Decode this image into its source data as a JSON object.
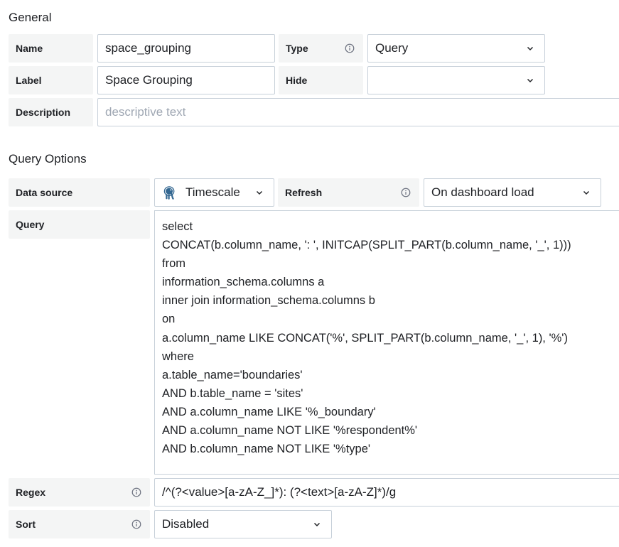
{
  "general": {
    "title": "General",
    "name_label": "Name",
    "name_value": "space_grouping",
    "type_label": "Type",
    "type_value": "Query",
    "label_label": "Label",
    "label_value": "Space Grouping",
    "hide_label": "Hide",
    "hide_value": "",
    "description_label": "Description",
    "description_placeholder": "descriptive text"
  },
  "query_options": {
    "title": "Query Options",
    "datasource_label": "Data source",
    "datasource_value": "Timescale",
    "refresh_label": "Refresh",
    "refresh_value": "On dashboard load",
    "query_label": "Query",
    "query_lines": [
      "select",
      "CONCAT(b.column_name, ': ', INITCAP(SPLIT_PART(b.column_name, '_', 1)))",
      "from",
      "information_schema.columns a",
      "inner join information_schema.columns b",
      "on",
      "a.column_name LIKE CONCAT('%', SPLIT_PART(b.column_name, '_', 1), '%')",
      "where",
      "a.table_name='boundaries'",
      "AND b.table_name = 'sites'",
      "AND a.column_name LIKE '%_boundary'",
      "AND a.column_name NOT LIKE '%respondent%'",
      "AND b.column_name NOT LIKE '%type'"
    ],
    "regex_label": "Regex",
    "regex_value": "/^(?<value>[a-zA-Z_]*): (?<text>[a-zA-Z]*)/g",
    "sort_label": "Sort",
    "sort_value": "Disabled"
  },
  "icons": {
    "info": "info-circle-icon",
    "chevron": "chevron-down-icon",
    "datasource": "postgres-elephant-icon"
  },
  "colors": {
    "label_bg": "#f4f5f5",
    "border": "#c7d0d9",
    "text": "#202226",
    "placeholder": "#9fa7b3",
    "icon_gray": "#6e7381",
    "postgres_blue": "#336791"
  }
}
